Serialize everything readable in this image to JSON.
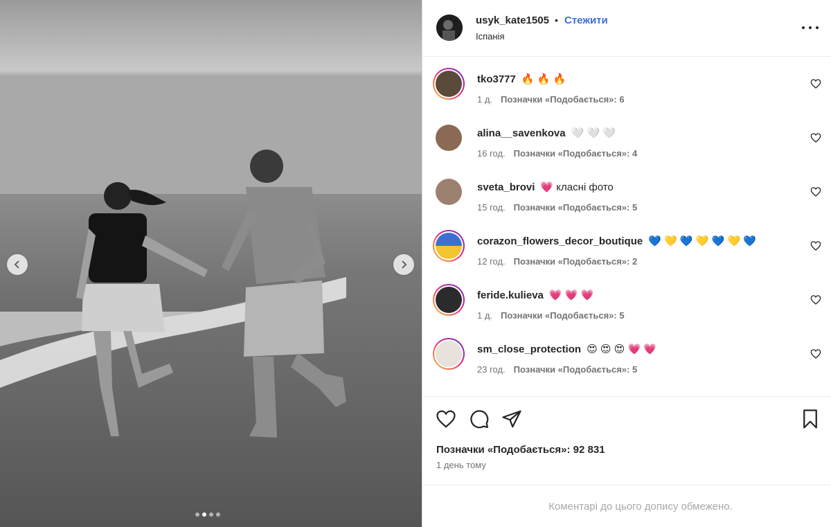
{
  "header": {
    "username": "usyk_kate1505",
    "separator": "•",
    "follow_label": "Стежити",
    "location": "Іспанія"
  },
  "comments": [
    {
      "username": "tko3777",
      "text": "",
      "emoji": "🔥 🔥 🔥",
      "time": "1 д.",
      "likes": "Позначки «Подобається»: 6",
      "story_ring": true,
      "avatar_color": "#5a4a3a"
    },
    {
      "username": "alina__savenkova",
      "text": "",
      "emoji": "🤍 🤍 🤍",
      "time": "16 год.",
      "likes": "Позначки «Подобається»: 4",
      "story_ring": false,
      "avatar_color": "#8a6a55"
    },
    {
      "username": "sveta_brovi",
      "text": "класні фото",
      "emoji": "💗",
      "time": "15 год.",
      "likes": "Позначки «Подобається»: 5",
      "story_ring": false,
      "avatar_color": "#9c8070"
    },
    {
      "username": "corazon_flowers_decor_boutique",
      "text": "",
      "emoji": "💙 💛 💙 💛 💙 💛 💙",
      "time": "12 год.",
      "likes": "Позначки «Подобається»: 2",
      "story_ring": true,
      "avatar_color": "#3d6fd1"
    },
    {
      "username": "feride.kulieva",
      "text": "",
      "emoji": "💗 💗 💗",
      "time": "1 д.",
      "likes": "Позначки «Подобається»: 5",
      "story_ring": true,
      "avatar_color": "#2b2b2b"
    },
    {
      "username": "sm_close_protection",
      "text": "",
      "emoji": "😍 😍 😍 💗 💗",
      "time": "23 год.",
      "likes": "Позначки «Подобається»: 5",
      "story_ring": true,
      "avatar_color": "#e8e2dc"
    }
  ],
  "actions": {
    "like_icon": "heart-icon",
    "comment_icon": "comment-icon",
    "share_icon": "paper-plane-icon",
    "save_icon": "bookmark-icon"
  },
  "likes_total": "Позначки «Подобається»: 92 831",
  "time_ago": "1 день тому",
  "comments_restricted": "Коментарі до цього допису обмежено.",
  "carousel": {
    "slide_count": 4,
    "active_slide": 2
  },
  "colors": {
    "follow": "#3e6fd8",
    "meta": "#737373",
    "footer_text": "#a8a8a8"
  }
}
